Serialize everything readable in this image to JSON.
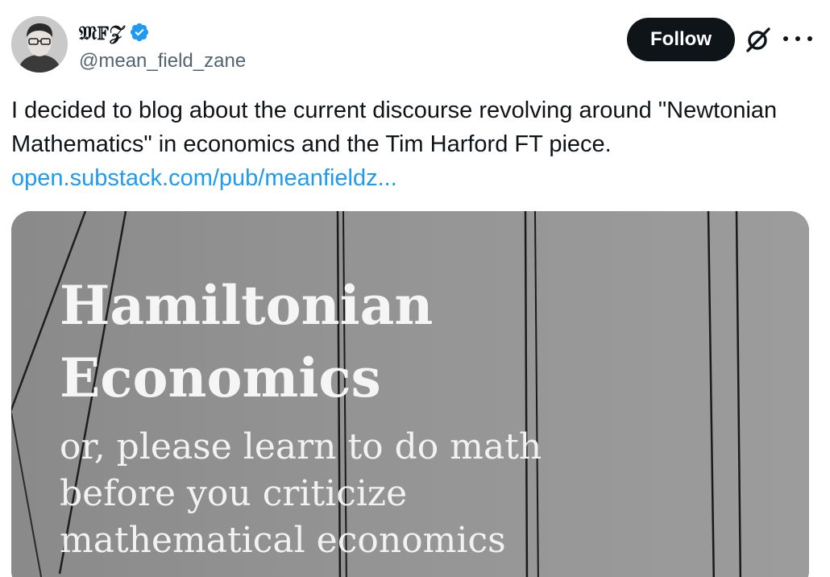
{
  "author": {
    "display_name": "𝔐𝔽𝒵",
    "handle": "@mean_field_zane",
    "verified": true
  },
  "actions": {
    "follow_label": "Follow"
  },
  "tweet": {
    "text": "I decided to blog about the current discourse revolving around \"Newtonian\nMathematics\" in economics and the Tim Harford FT piece.",
    "link": "open.substack.com/pub/meanfieldz..."
  },
  "media": {
    "title_line1": "Hamiltonian",
    "title_line2": "Economics",
    "subtitle": "or, please learn to do math\nbefore you criticize\nmathematical economics"
  },
  "colors": {
    "link": "#1d9bf0",
    "verified_badge": "#1d9bf0",
    "follow_button_bg": "#0f1419",
    "handle_text": "#536471"
  },
  "icons": {
    "verified": "verified-badge-icon",
    "grok": "grok-slash-icon",
    "more": "more-dots-icon"
  }
}
